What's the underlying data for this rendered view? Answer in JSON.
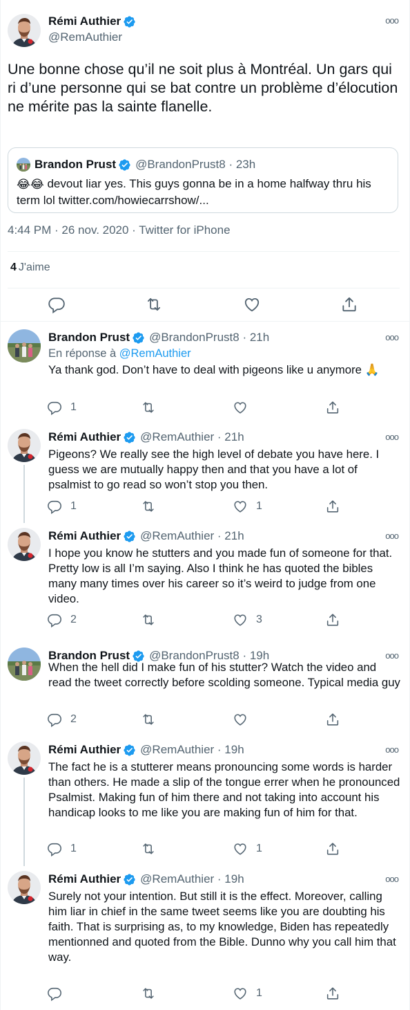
{
  "main_tweet": {
    "author_name": "Rémi Authier",
    "author_handle": "@RemAuthier",
    "text": "Une bonne chose qu’il ne soit plus à Montréal. Un gars qui ri d’une personne qui se bat contre un problème d’élocution ne mérite pas la sainte flanelle.",
    "quote": {
      "author_name": "Brandon Prust",
      "author_handle": "@BrandonPrust8 · 23h",
      "emoji": "😂😂",
      "text": " devout liar yes. This guys gonna be in a home halfway thru his term lol twitter.com/howiecarrshow/..."
    },
    "meta": "4:44 PM · 26 nov. 2020 · Twitter for iPhone",
    "likes_count": "4",
    "likes_label": "J'aime"
  },
  "replies": [
    {
      "author_name": "Brandon Prust",
      "author_handle": "@BrandonPrust8 · 21h",
      "reply_to_prefix": "En réponse à ",
      "reply_to_handle": "@RemAuthier",
      "text": "Ya thank god. Don’t have to deal with pigeons like u anymore 🙏",
      "reply_count": "1",
      "retweet_count": "",
      "like_count": ""
    },
    {
      "author_name": "Rémi Authier",
      "author_handle": "@RemAuthier · 21h",
      "text": "Pigeons? We really see the high level of debate you have here. I guess we are mutually happy then and that you have a lot of psalmist to go read so won’t stop you then.",
      "reply_count": "1",
      "retweet_count": "",
      "like_count": "1"
    },
    {
      "author_name": "Rémi Authier",
      "author_handle": "@RemAuthier · 21h",
      "text": "I hope you know he stutters and you made fun of someone for that. Pretty low is all I’m saying. Also I think he has quoted the bibles many many times over his career so it’s weird to judge from one video.",
      "reply_count": "2",
      "retweet_count": "",
      "like_count": "3"
    },
    {
      "author_name": "Brandon Prust",
      "author_handle": "@BrandonPrust8 · 19h",
      "text": "When the hell did I make fun of his stutter? Watch the video and read the tweet correctly before scolding someone. Typical media guy",
      "reply_count": "2",
      "retweet_count": "",
      "like_count": ""
    },
    {
      "author_name": "Rémi Authier",
      "author_handle": "@RemAuthier · 19h",
      "text": "The fact he is a stutterer means pronouncing some words is harder than others. He made a slip of the tongue errer when he pronounced Psalmist. Making fun of him there and not taking into account his handicap looks to me like you are making fun of him for that.",
      "reply_count": "1",
      "retweet_count": "",
      "like_count": "1"
    },
    {
      "author_name": "Rémi Authier",
      "author_handle": "@RemAuthier · 19h",
      "text": "Surely not your intention. But still it is the effect. Moreover, calling him liar in chief in the same tweet seems like you are doubting his faith. That is surprising as, to my knowledge, Biden has repeatedly mentionned and quoted from the Bible. Dunno why you call him that way.",
      "reply_count": "",
      "retweet_count": "",
      "like_count": "1"
    }
  ],
  "colors": {
    "text": "#0f1419",
    "secondary": "#536471",
    "link": "#1d9bf0",
    "verified": "#1d9bf0",
    "border": "#eff3f4",
    "thread_line": "#cfd9de"
  }
}
